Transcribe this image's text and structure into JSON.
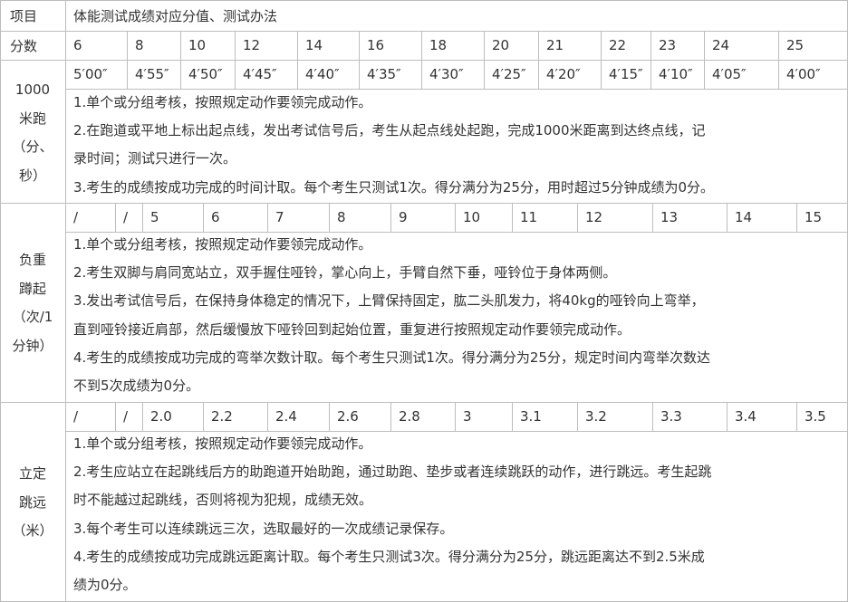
{
  "header": {
    "item_label": "项目",
    "score_label": "分数",
    "title": "体能测试成绩对应分值、测试办法",
    "scores": [
      "6",
      "8",
      "10",
      "12",
      "14",
      "16",
      "18",
      "20",
      "21",
      "22",
      "23",
      "24",
      "25"
    ]
  },
  "sections": [
    {
      "name_lines": [
        "1000",
        "米跑",
        "（分、",
        "秒）"
      ],
      "values": [
        "5′00″",
        "4′55″",
        "4′50″",
        "4′45″",
        "4′40″",
        "4′35″",
        "4′30″",
        "4′25″",
        "4′20″",
        "4′15″",
        "4′10″",
        "4′05″",
        "4′00″"
      ],
      "rule_lines": [
        "1.单个或分组考核，按照规定动作要领完成动作。",
        "2.在跑道或平地上标出起点线，发出考试信号后，考生从起点线处起跑，完成1000米距离到达终点线，记",
        "录时间；测试只进行一次。",
        "3.考生的成绩按成功完成的时间计取。每个考生只测试1次。得分满分为25分，用时超过5分钟成绩为0分。"
      ]
    },
    {
      "name_lines": [
        "负重",
        "蹲起",
        "（次/1",
        "分钟）"
      ],
      "values": [
        "/",
        "/",
        "5",
        "6",
        "7",
        "8",
        "9",
        "10",
        "11",
        "12",
        "13",
        "14",
        "15"
      ],
      "rule_lines": [
        "1.单个或分组考核，按照规定动作要领完成动作。",
        "2.考生双脚与肩同宽站立，双手握住哑铃，掌心向上，手臂自然下垂，哑铃位于身体两侧。",
        "3.发出考试信号后，在保持身体稳定的情况下，上臂保持固定，肱二头肌发力，将40kg的哑铃向上弯举，",
        "直到哑铃接近肩部，然后缓慢放下哑铃回到起始位置，重复进行按照规定动作要领完成动作。",
        "4.考生的成绩按成功完成的弯举次数计取。每个考生只测试1次。得分满分为25分，规定时间内弯举次数达",
        "不到5次成绩为0分。"
      ]
    },
    {
      "name_lines": [
        "立定",
        "跳远",
        "（米）"
      ],
      "values": [
        "/",
        "/",
        "2.0",
        "2.2",
        "2.4",
        "2.6",
        "2.8",
        "3",
        "3.1",
        "3.2",
        "3.3",
        "3.4",
        "3.5"
      ],
      "rule_lines": [
        "1.单个或分组考核，按照规定动作要领完成动作。",
        "2.考生应站立在起跳线后方的助跑道开始助跑，通过助跑、垫步或者连续跳跃的动作，进行跳远。考生起跳",
        "时不能越过起跳线，否则将视为犯规，成绩无效。",
        "3.每个考生可以连续跳远三次，选取最好的一次成绩记录保存。",
        "4.考生的成绩按成功完成跳远距离计取。每个考生只测试3次。得分满分为25分，跳远距离达不到2.5米成",
        "绩为0分。"
      ]
    }
  ]
}
